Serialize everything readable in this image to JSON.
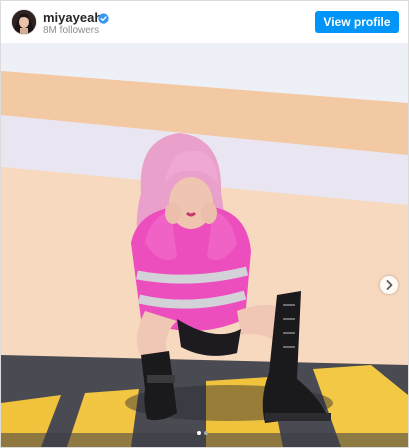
{
  "post": {
    "username": "miyayeah",
    "followers": "8M followers",
    "view_profile_label": "View profile",
    "carousel": {
      "total_slides": 2,
      "active_slide": 1
    }
  },
  "icons": {
    "verified": "verified-badge-icon",
    "next": "chevron-right-icon"
  },
  "colors": {
    "accent": "#0095f6",
    "verified": "#3897f0",
    "dot_active": "#ffffff",
    "dot_inactive": "#a8a8a8"
  }
}
